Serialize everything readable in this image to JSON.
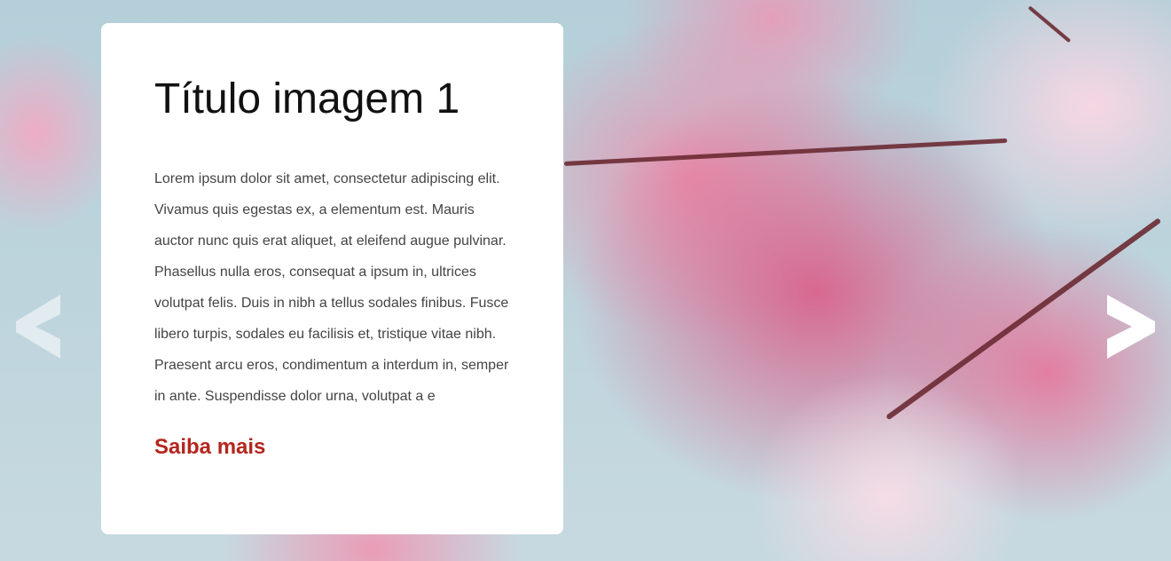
{
  "slide": {
    "title": "Título imagem 1",
    "description": "Lorem ipsum dolor sit amet, consectetur adipiscing elit. Vivamus quis egestas ex, a elementum est. Mauris auctor nunc quis erat aliquet, at eleifend augue pulvinar. Phasellus nulla eros, consequat a ipsum in, ultrices volutpat felis. Duis in nibh a tellus sodales finibus. Fusce libero turpis, sodales eu facilisis et, tristique vitae nibh. Praesent arcu eros, condimentum a interdum in, semper in ante. Suspendisse dolor urna, volutpat a e",
    "cta_label": "Saiba mais",
    "background_icon": "cherry-blossom-image"
  },
  "controls": {
    "prev_icon": "chevron-left-icon",
    "next_icon": "chevron-right-icon"
  },
  "colors": {
    "accent": "#b3261e",
    "card_bg": "#ffffff",
    "title": "#111111",
    "body": "#444444"
  }
}
